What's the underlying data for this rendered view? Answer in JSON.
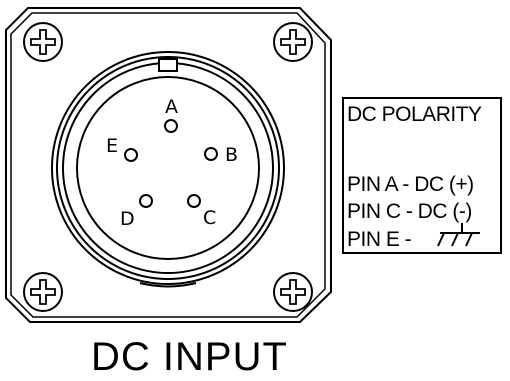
{
  "connector": {
    "pins": [
      {
        "label": "A"
      },
      {
        "label": "B"
      },
      {
        "label": "C"
      },
      {
        "label": "D"
      },
      {
        "label": "E"
      }
    ]
  },
  "legend": {
    "title": "DC POLARITY",
    "pin_a": "PIN A - DC (+)",
    "pin_c": "PIN C - DC (-)",
    "pin_e": "PIN E -",
    "ground_icon": "chassis-ground-icon"
  },
  "footer": {
    "label": "DC INPUT"
  },
  "icons": {
    "mounting_screw": "phillips-screw-icon"
  }
}
